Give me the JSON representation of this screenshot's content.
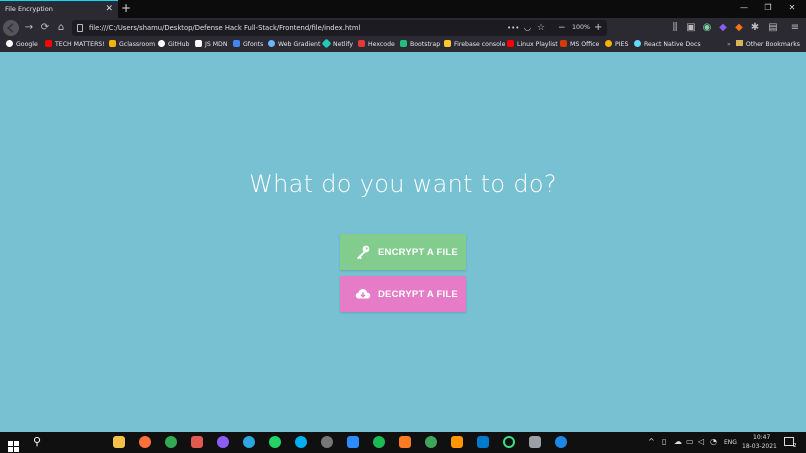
{
  "browser": {
    "tab_title": "File Encryption",
    "tab_close": "✕",
    "new_tab": "+",
    "url": "file:///C:/Users/shamu/Desktop/Defense Hack Full-Stack/Frontend/file/index.html",
    "zoom": "100%",
    "more": "•••",
    "window_controls": [
      "—",
      "❐",
      "✕"
    ]
  },
  "bookmarks": [
    {
      "label": "Google",
      "color": "#4285f4"
    },
    {
      "label": "TECH MATTERS!",
      "color": "#ff0000"
    },
    {
      "label": "Gclassroom",
      "color": "#f4b400"
    },
    {
      "label": "GitHub",
      "color": "#ffffff"
    },
    {
      "label": "JS MDN",
      "color": "#ffffff"
    },
    {
      "label": "Gfonts",
      "color": "#4285f4"
    },
    {
      "label": "Web Gradient",
      "color": "#6ab7ff"
    },
    {
      "label": "Netlify",
      "color": "#25c7b7"
    },
    {
      "label": "Hexcode",
      "color": "#e53935"
    },
    {
      "label": "Bootstrap",
      "color": "#21c07a"
    },
    {
      "label": "Firebase console",
      "color": "#ffca28"
    },
    {
      "label": "Linux Playlist",
      "color": "#ff0000"
    },
    {
      "label": "MS Office",
      "color": "#d83b01"
    },
    {
      "label": "PIES",
      "color": "#f4b400"
    },
    {
      "label": "React Native Docs",
      "color": "#61dafb"
    }
  ],
  "other_bookmarks": "Other Bookmarks",
  "main": {
    "heading": "What do you want to do?",
    "encrypt_label": "ENCRYPT A FILE",
    "decrypt_label": "DECRYPT A FILE",
    "background_color": "#77c1d3",
    "encrypt_color": "#82cc8e",
    "decrypt_color": "#e67cc7"
  },
  "taskbar": {
    "language": "ENG",
    "time": "10:47",
    "date": "18-03-2021",
    "notification_count": "2"
  }
}
